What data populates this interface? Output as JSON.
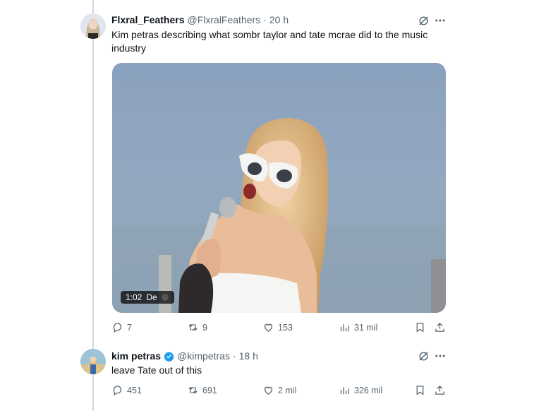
{
  "tweets": [
    {
      "display_name": "Flxral_Feathers",
      "handle": "@FlxralFeathers",
      "separator": "·",
      "time": "20 h",
      "text": "Kim petras describing what sombr taylor and tate mcrae did to the music industry",
      "media": {
        "duration": "1:02",
        "caption_stub": "De"
      },
      "actions": {
        "replies": "7",
        "reposts": "9",
        "likes": "153",
        "views": "31 mil"
      }
    },
    {
      "display_name": "kim petras",
      "verified": true,
      "handle": "@kimpetras",
      "separator": "·",
      "time": "18 h",
      "text": "leave Tate out of this",
      "actions": {
        "replies": "451",
        "reposts": "691",
        "likes": "2 mil",
        "views": "326 mil"
      }
    }
  ],
  "icons": [
    "grok-icon",
    "more-icon",
    "reply-icon",
    "repost-icon",
    "like-icon",
    "views-icon",
    "bookmark-icon",
    "share-icon",
    "verified-icon"
  ],
  "colors": {
    "verified_blue": "#1d9bf0",
    "text": "#0f1419",
    "muted": "#536471",
    "thread_line": "#cfd9de"
  }
}
